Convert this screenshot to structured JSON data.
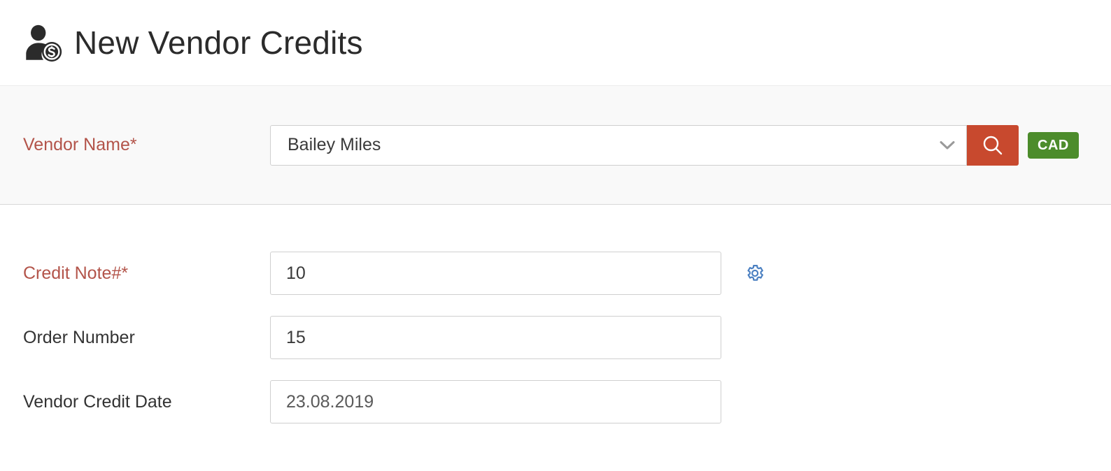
{
  "header": {
    "title": "New Vendor Credits",
    "icon": "vendor-credit-person-dollar-icon"
  },
  "vendor_section": {
    "label": "Vendor Name*",
    "selected_value": "Bailey Miles",
    "dropdown_icon": "chevron-down-icon",
    "search_icon": "search-icon",
    "currency_badge": "CAD",
    "colors": {
      "required_label": "#b3544a",
      "search_button": "#c8492e",
      "currency_badge": "#4c8c2b",
      "band_background": "#f9f9f9"
    }
  },
  "form": {
    "rows": [
      {
        "label": "Credit Note#*",
        "required": true,
        "value": "10",
        "placeholder": "",
        "has_settings_icon": true,
        "settings_icon": "gear-icon"
      },
      {
        "label": "Order Number",
        "required": false,
        "value": "15",
        "placeholder": "",
        "has_settings_icon": false
      },
      {
        "label": "Vendor Credit Date",
        "required": false,
        "value": "23.08.2019",
        "placeholder": "",
        "has_settings_icon": false
      }
    ]
  }
}
